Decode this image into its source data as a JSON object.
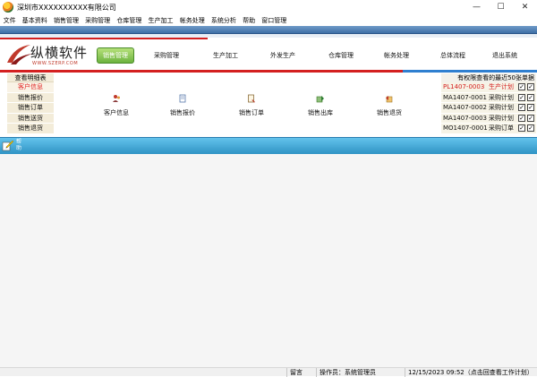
{
  "window": {
    "title": "深圳市XXXXXXXXXX有限公司",
    "controls": {
      "minimize": "—",
      "maximize": "☐",
      "close": "✕"
    }
  },
  "menu": [
    "文件",
    "基本资料",
    "销售管理",
    "采购管理",
    "仓库管理",
    "生产加工",
    "帐务处理",
    "系统分析",
    "帮助",
    "窗口管理"
  ],
  "logo": {
    "name": "纵横软件",
    "url": "WWW.SZERP.COM"
  },
  "nav": [
    {
      "label": "销售管理",
      "active": true
    },
    {
      "label": "采购管理",
      "active": false
    },
    {
      "label": "生产加工",
      "active": false
    },
    {
      "label": "外发生产",
      "active": false
    },
    {
      "label": "仓库管理",
      "active": false
    },
    {
      "label": "帐务处理",
      "active": false
    },
    {
      "label": "总体流程",
      "active": false
    },
    {
      "label": "退出系统",
      "active": false
    }
  ],
  "left_panel": {
    "header": "查看明细表",
    "items": [
      {
        "label": "客户信息",
        "active": true
      },
      {
        "label": "销售报价",
        "active": false
      },
      {
        "label": "销售订单",
        "active": false
      },
      {
        "label": "销售送货",
        "active": false
      },
      {
        "label": "销售退货",
        "active": false
      }
    ]
  },
  "functions": [
    {
      "label": "客户信息",
      "icon": "customer-icon"
    },
    {
      "label": "销售报价",
      "icon": "document-icon"
    },
    {
      "label": "销售订单",
      "icon": "order-icon"
    },
    {
      "label": "销售出库",
      "icon": "warehouse-out-icon"
    },
    {
      "label": "销售退货",
      "icon": "return-icon"
    }
  ],
  "right_panel": {
    "header": "有权限查看的最近50张单据",
    "rows": [
      {
        "id": "PL1407-0003",
        "type": "生产计划",
        "highlight": true,
        "check1": true,
        "check2": true
      },
      {
        "id": "MA1407-0001",
        "type": "采购计划",
        "highlight": false,
        "check1": true,
        "check2": true
      },
      {
        "id": "MA1407-0002",
        "type": "采购计划",
        "highlight": false,
        "check1": true,
        "check2": true
      },
      {
        "id": "MA1407-0003",
        "type": "采购计划",
        "highlight": false,
        "check1": true,
        "check2": true
      },
      {
        "id": "MO1407-0001",
        "type": "采购订单",
        "highlight": false,
        "check1": true,
        "check2": true
      }
    ]
  },
  "help": {
    "label": "帮\n助"
  },
  "status_bar": {
    "message": "留言",
    "operator": "操作员：系统管理员",
    "datetime": "12/15/2023 09:52（点击回查看工作计划）"
  },
  "colors": {
    "accent_red": "#d42020",
    "band_blue": "#3e6fa6",
    "divider_blue": "#2f93c4",
    "nav_active_green": "#6db33f"
  }
}
